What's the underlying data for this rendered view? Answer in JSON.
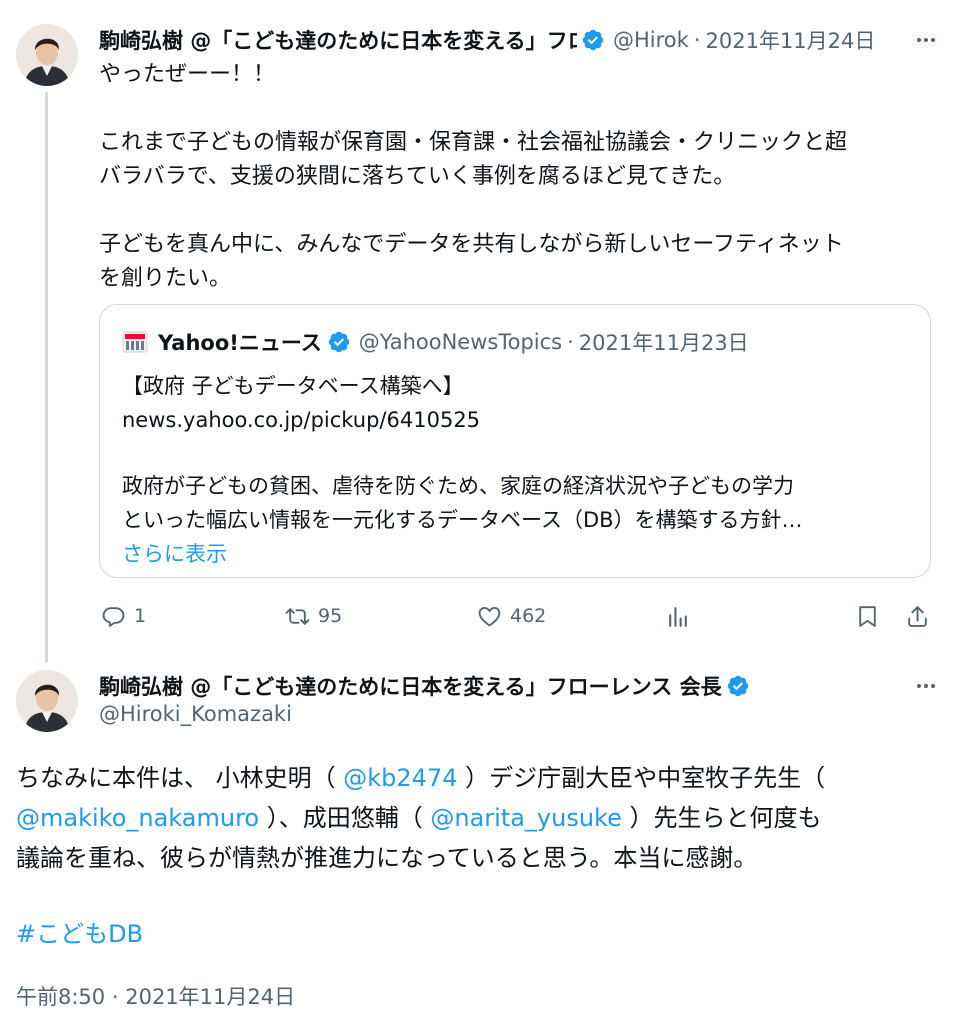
{
  "colors": {
    "accent": "#1d9bf0",
    "secondary_text": "#536471",
    "border": "#cfd9de",
    "text": "#0f1419"
  },
  "tweet1": {
    "avatar": "avatar-photo",
    "display_name": "駒崎弘樹 @「こども達のために日本を変える」フローレンス 会長",
    "verified_icon": "verified-badge-icon",
    "handle": "@Hirok",
    "separator": "·",
    "date": "2021年11月24日",
    "more_icon": "more-options-icon",
    "lines": [
      "やったぜーー！！",
      "",
      "これまで子どもの情報が保育園・保育課・社会福祉協議会・クリニックと超",
      "バラバラで、支援の狭間に落ちていく事例を腐るほど見てきた。",
      "",
      "子どもを真ん中に、みんなでデータを共有しながら新しいセーフティネット",
      "を創りたい。"
    ],
    "quote": {
      "logo": "yahoo-news-logo",
      "name": "Yahoo!ニュース",
      "handle": "@YahooNewsTopics",
      "separator": "·",
      "date": "2021年11月23日",
      "title": "【政府 子どもデータベース構築へ】",
      "url": "news.yahoo.co.jp/pickup/6410525",
      "text1": "政府が子どもの貧困、虐待を防ぐため、家庭の経済状況や子どもの学力",
      "text2": "といった幅広い情報を一元化するデータベース（DB）を構築する方針…",
      "show_more": "さらに表示"
    },
    "actions": {
      "reply_count": "1",
      "retweet_count": "95",
      "like_count": "462",
      "icons": [
        "reply-icon",
        "retweet-icon",
        "like-icon",
        "views-icon",
        "bookmark-icon",
        "share-icon"
      ]
    }
  },
  "tweet2": {
    "avatar": "avatar-photo",
    "display_name": "駒崎弘樹 @「こども達のために日本を変える」フローレンス 会長",
    "handle": "@Hiroki_Komazaki",
    "line1_a": "ちなみに本件は、 小林史明（ ",
    "mention1": "@kb2474",
    "line1_b": " ）デジ庁副大臣や中室牧子先生（",
    "mention2": "@makiko_nakamuro",
    "line2_a": " ）、成田悠輔（ ",
    "mention3": "@narita_yusuke",
    "line2_b": " ）先生らと何度も",
    "line3": "議論を重ね、彼らが情熱が推進力になっていると思う。本当に感謝。",
    "hashtag": "#こどもDB",
    "time": "午前8:50",
    "separator": "·",
    "date": "2021年11月24日"
  }
}
